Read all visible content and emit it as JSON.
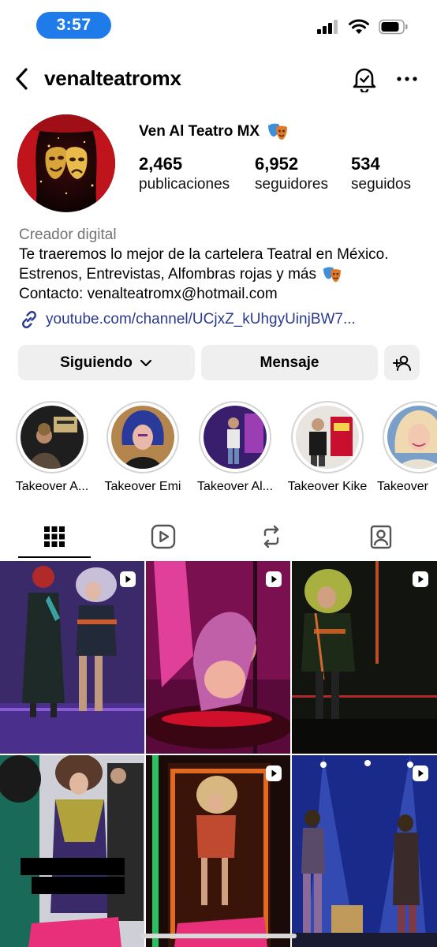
{
  "status_bar": {
    "time": "3:57"
  },
  "header": {
    "username": "venalteatromx"
  },
  "profile": {
    "display_name": "Ven Al Teatro MX",
    "name_emoji_icon": "performing-arts-masks-icon",
    "stats": [
      {
        "value": "2,465",
        "label": "publicaciones"
      },
      {
        "value": "6,952",
        "label": "seguidores"
      },
      {
        "value": "534",
        "label": "seguidos"
      }
    ],
    "category": "Creador digital",
    "bio_lines": [
      "Te traeremos lo mejor de la cartelera Teatral en México.",
      "Estrenos, Entrevistas, Alfombras rojas y más",
      "Contacto: venalteatromx@hotmail.com"
    ],
    "link": "youtube.com/channel/UCjxZ_kUhgyUinjBW7..."
  },
  "actions": {
    "following_label": "Siguiendo",
    "message_label": "Mensaje"
  },
  "highlights": [
    {
      "label": "Takeover A...",
      "colors": [
        "#2b2b2b",
        "#c9b27a"
      ]
    },
    {
      "label": "Takeover Emi",
      "colors": [
        "#2a3a9a",
        "#d98aa0"
      ]
    },
    {
      "label": "Takeover Al...",
      "colors": [
        "#3a1e6e",
        "#c44ad0"
      ]
    },
    {
      "label": "Takeover Kike",
      "colors": [
        "#ececec",
        "#c8102e"
      ]
    },
    {
      "label": "Takeover",
      "colors": [
        "#f0d9b0",
        "#7aa0c8"
      ]
    }
  ],
  "tabs": [
    "grid-tab",
    "reels-tab",
    "reposts-tab",
    "tagged-tab"
  ],
  "colors": {
    "link": "#2b3a8f",
    "button_bg": "#efefef",
    "time_pill": "#1f7bea"
  }
}
